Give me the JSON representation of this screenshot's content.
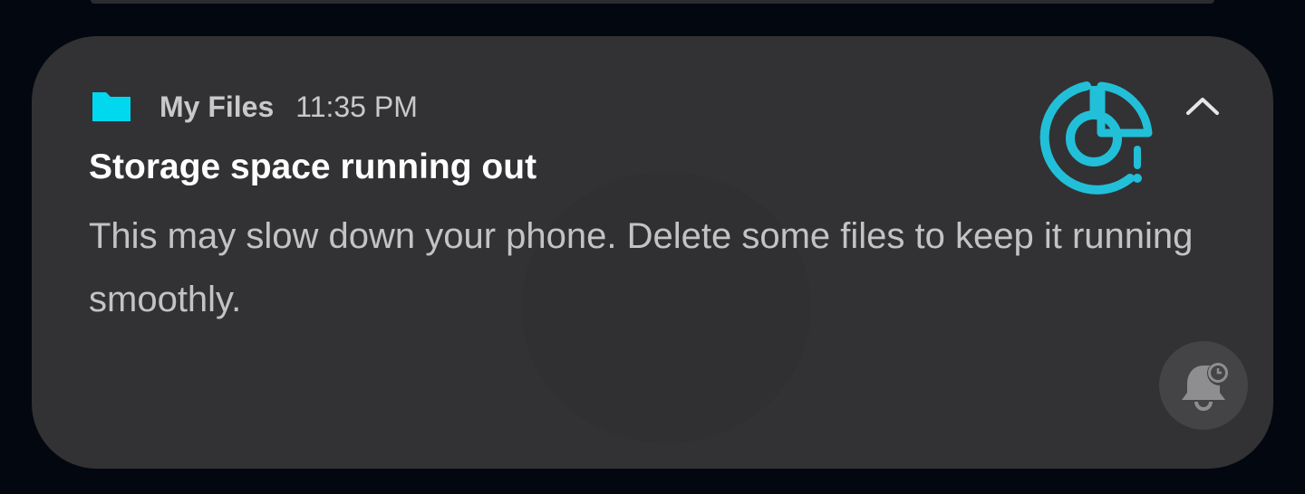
{
  "notification": {
    "app_name": "My Files",
    "time": "11:35 PM",
    "title": "Storage space running out",
    "body": "This may slow down your phone. Delete some files to keep it running smoothly.",
    "app_icon": "folder-icon",
    "large_icon": "storage-warning-icon",
    "collapse_icon": "chevron-up-icon",
    "snooze_icon": "snooze-bell-icon"
  },
  "colors": {
    "background": "#030810",
    "card": "#323234",
    "accent": "#22bfd9",
    "folder": "#00d8f0",
    "title": "#ffffff",
    "body": "#c3c3c5"
  }
}
